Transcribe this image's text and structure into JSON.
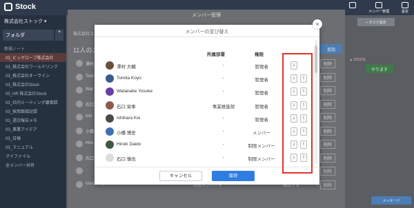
{
  "app": {
    "logo": "Stock",
    "top_icons": [
      {
        "label": "",
        "icon": "check-icon"
      },
      {
        "label": "メンバー管理",
        "icon": "members-icon"
      },
      {
        "label": "設定",
        "icon": "settings-icon"
      }
    ]
  },
  "sidebar": {
    "company": "株式会社ストック ▾",
    "folder_tab": "フォルダ",
    "folder_add": "+",
    "section": "新規ノート",
    "items": [
      "03_ビッグローブ株式会社",
      "03_株式会社ワールドリンク",
      "03_株式会社オーライン",
      "03_株式会社Stock",
      "03_HR 株式会社Stock",
      "03_社内ミーティング議事録",
      "03_採用面接記録",
      "03_週次報告メモ",
      "03_事業アイデア",
      "03_日報",
      "03_マニュアル",
      "マイファイル",
      "全メンバー共有"
    ]
  },
  "manager": {
    "title": "メンバー管理",
    "company_line": "株式会社ス",
    "count": "11人のメ",
    "add_button": "追加",
    "task_button": "+ タスク設定",
    "badge": "▲ 2022/11",
    "green_button": "やります",
    "bg_rows": [
      {
        "name": "澤村",
        "role": "",
        "date": "",
        "link": "",
        "del": "削除"
      },
      {
        "name": "Tom",
        "role": "",
        "date": "",
        "link": "",
        "del": "削除"
      },
      {
        "name": "Wat",
        "role": "",
        "date": "",
        "link": "",
        "del": "削除"
      },
      {
        "name": "石口",
        "role": "",
        "date": "",
        "link": "",
        "del": "削除"
      },
      {
        "name": "Ishi",
        "role": "",
        "date": "",
        "link": "",
        "del": "削除"
      },
      {
        "name": "小橋",
        "role": "",
        "date": "",
        "link": "",
        "del": "削除"
      },
      {
        "name": "Hiro",
        "role": "",
        "date": "",
        "link": "",
        "del": "削除"
      },
      {
        "name": "石口",
        "role": "",
        "date": "",
        "link": "",
        "del": "削除"
      },
      {
        "name": "",
        "role": "",
        "date": "",
        "link": "",
        "del": "削除"
      },
      {
        "name": "Maki Ishiguchi",
        "role": "制限メンバー ▾",
        "date": "2021/05/06 12:06",
        "link": "確認する",
        "del": "削除"
      }
    ],
    "bottom_chip": "メッセージ"
  },
  "modal": {
    "title": "メンバーの並び替え",
    "col_dept": "所属部署",
    "col_role": "権限",
    "rows": [
      {
        "name": "澤村 大輔",
        "dept": "-",
        "role": "管理者",
        "avatar": "#6b4f3a",
        "up": false,
        "down": true
      },
      {
        "name": "Tomita Koyo",
        "dept": "-",
        "role": "管理者",
        "avatar": "#3a5b8c",
        "up": true,
        "down": true
      },
      {
        "name": "Watanabe Yosuke",
        "dept": "-",
        "role": "管理者",
        "avatar": "#6a3fa8",
        "up": true,
        "down": true
      },
      {
        "name": "石口 栄季",
        "dept": "事業推進部",
        "role": "管理者",
        "avatar": "#8a5a4a",
        "up": true,
        "down": true
      },
      {
        "name": "Ishihara Kei",
        "dept": "-",
        "role": "管理者",
        "avatar": "#4a4a4a",
        "up": true,
        "down": true
      },
      {
        "name": "小橋 博史",
        "dept": "-",
        "role": "メンバー",
        "avatar": "#3f6fb0",
        "up": true,
        "down": true
      },
      {
        "name": "Hiroki Daido",
        "dept": "-",
        "role": "制限メンバー",
        "avatar": "#3b5a3f",
        "up": true,
        "down": true
      },
      {
        "name": "石口 慎也",
        "dept": "-",
        "role": "制限メンバー",
        "avatar": "#dcdcdc",
        "up": true,
        "down": true
      }
    ],
    "arrow_down": "↓",
    "arrow_up": "↑",
    "cancel": "キャンセル",
    "save": "保存",
    "close": "×"
  }
}
